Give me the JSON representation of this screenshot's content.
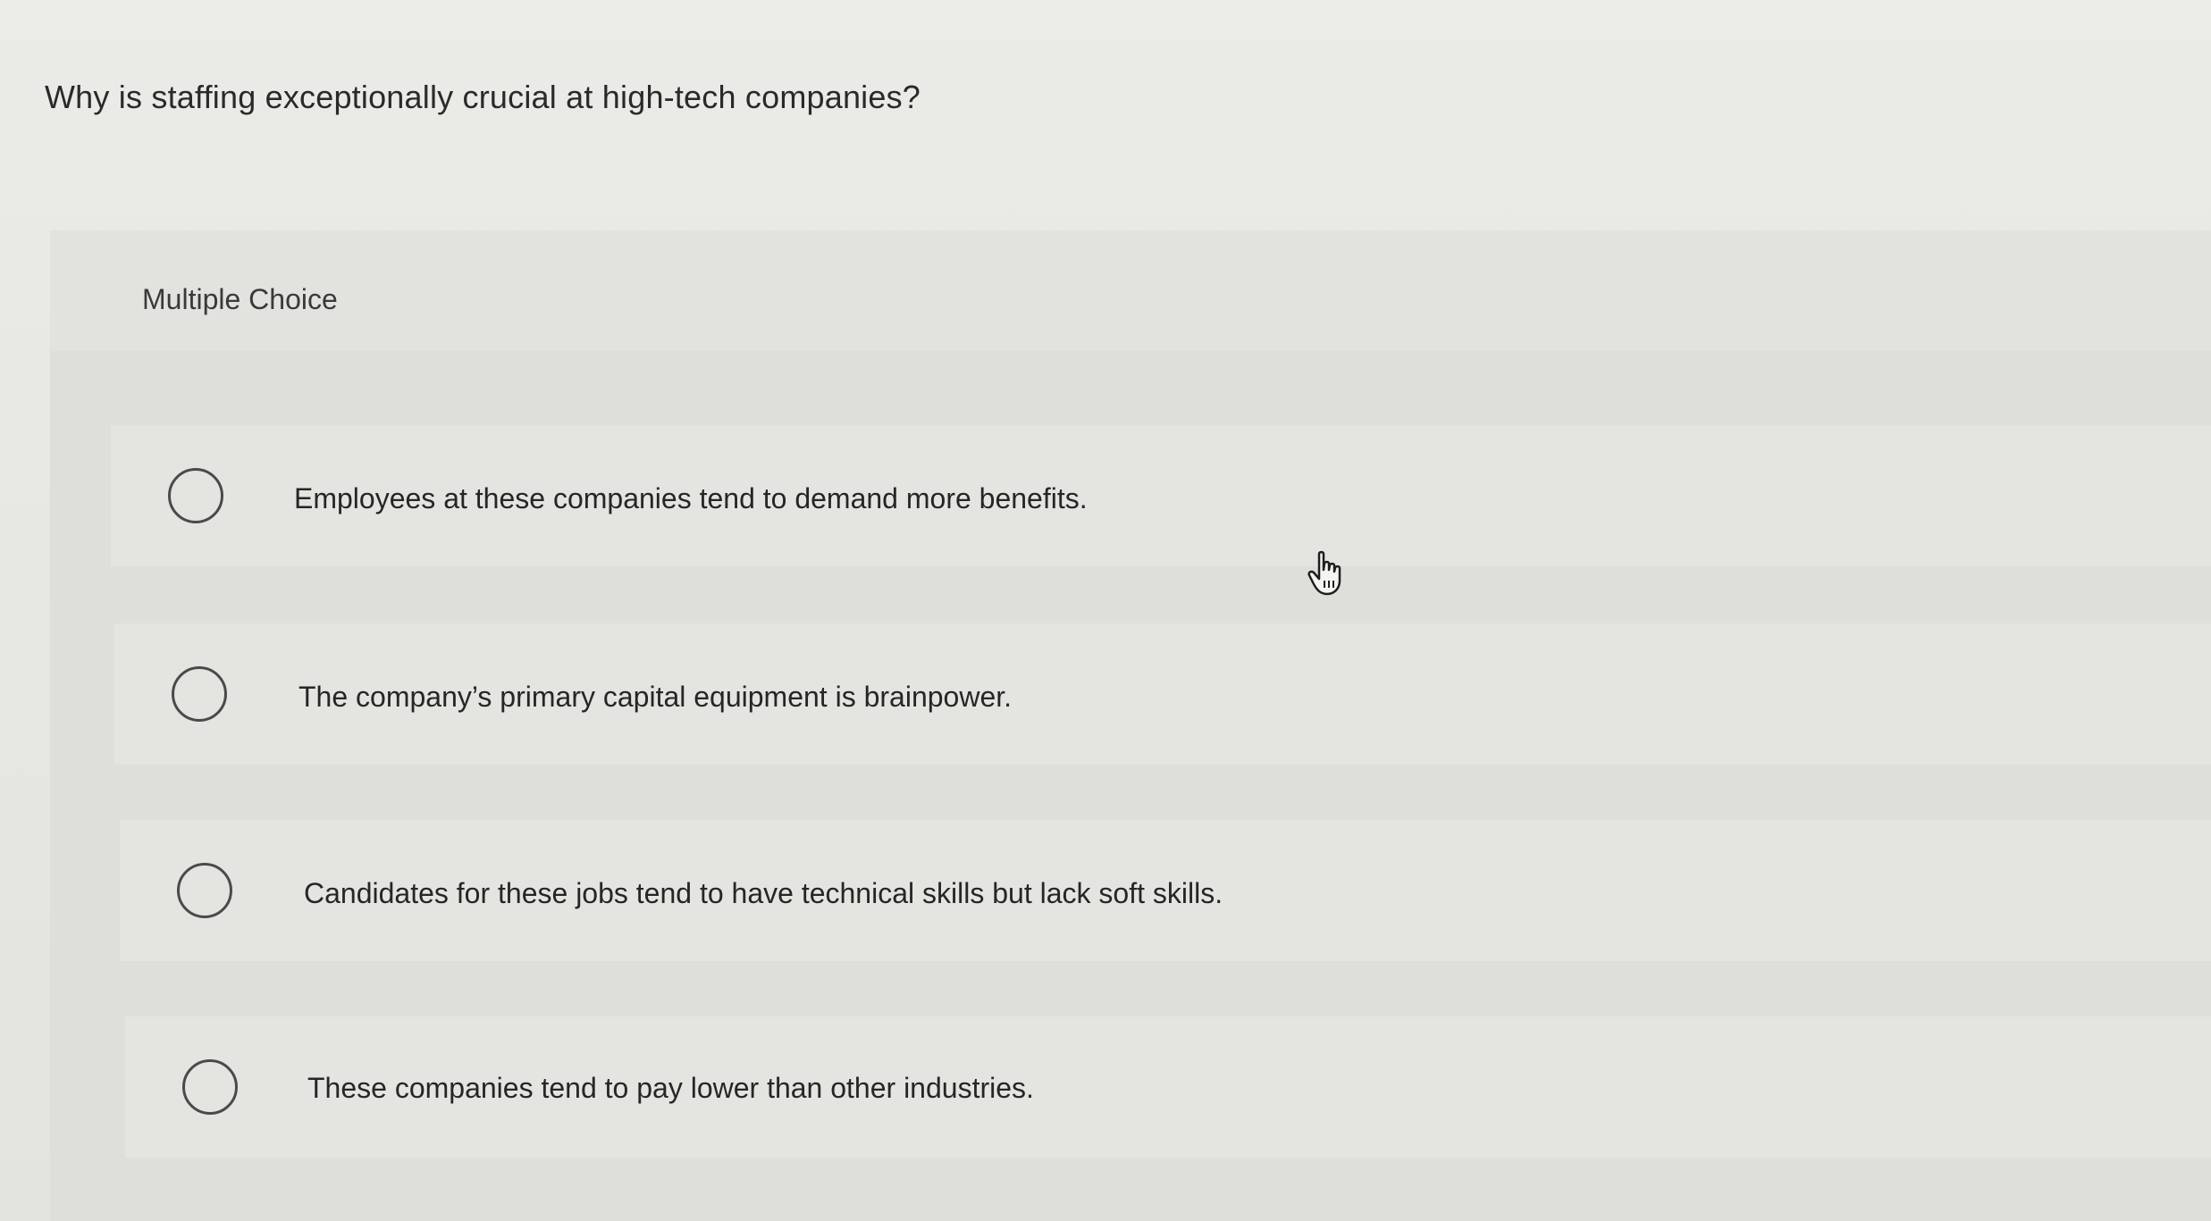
{
  "question": {
    "text": "Why is staffing exceptionally crucial at high-tech companies?"
  },
  "panel": {
    "label": "Multiple Choice"
  },
  "options": [
    {
      "text": "Employees at these companies tend to demand more benefits.",
      "selected": false
    },
    {
      "text": "The company’s primary capital equipment is brainpower.",
      "selected": false
    },
    {
      "text": "Candidates for these jobs tend to have technical skills but lack soft skills.",
      "selected": false
    },
    {
      "text": "These companies tend to pay lower than other industries.",
      "selected": false
    }
  ],
  "icons": {
    "radio": "radio-unselected-icon",
    "cursor": "hand-pointer-icon"
  }
}
